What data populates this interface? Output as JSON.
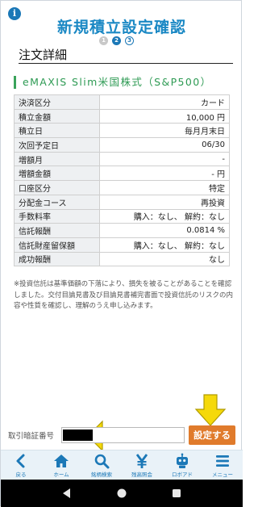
{
  "header": {
    "info_icon": "i",
    "title": "新規積立設定確認",
    "steps": [
      "1",
      "2",
      "3"
    ]
  },
  "section_title": "注文詳細",
  "fund_name": "eMAXIS Slim米国株式（S&P500）",
  "details": [
    {
      "label": "決済区分",
      "value": "カード"
    },
    {
      "label": "積立金額",
      "value": "10,000 円"
    },
    {
      "label": "積立日",
      "value": "毎月月末日"
    },
    {
      "label": "次回予定日",
      "value": "06/30"
    },
    {
      "label": "増額月",
      "value": "-"
    },
    {
      "label": "増額金額",
      "value": "- 円"
    },
    {
      "label": "口座区分",
      "value": "特定"
    },
    {
      "label": "分配金コース",
      "value": "再投資"
    },
    {
      "label": "手数料率",
      "value": "購入：なし、 解約：なし"
    },
    {
      "label": "信託報酬",
      "value": "0.0814 %"
    },
    {
      "label": "信託財産留保額",
      "value": "購入：なし、 解約：なし"
    },
    {
      "label": "成功報酬",
      "value": "なし"
    }
  ],
  "notice": "※投資信託は基準価額の下落により、損失を被ることがあることを確認しました。交付目論見書及び目論見書補完書面で投資信託のリスクの内容や性質を確認し、理解のうえ申し込みます。",
  "pin": {
    "label": "取引暗証番号",
    "placeholder": ""
  },
  "submit_label": "設定する",
  "nav": [
    {
      "label": "戻る",
      "icon": "back-icon"
    },
    {
      "label": "ホーム",
      "icon": "home-icon"
    },
    {
      "label": "銘柄検索",
      "icon": "search-icon"
    },
    {
      "label": "残高照会",
      "icon": "yen-icon"
    },
    {
      "label": "ロボアド",
      "icon": "robot-icon"
    },
    {
      "label": "メニュー",
      "icon": "menu-icon"
    }
  ],
  "colors": {
    "title": "#1a88c4",
    "fund": "#2d9a53",
    "submit": "#e07b2c",
    "arrow": "#f5d90a",
    "nav_bg": "#e9f2f8"
  }
}
